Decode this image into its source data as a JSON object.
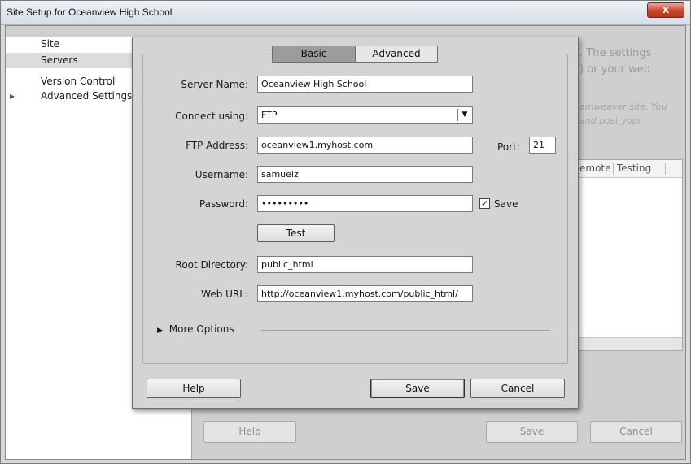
{
  "window": {
    "title": "Site Setup for Oceanview High School",
    "close_glyph": "x"
  },
  "sidebar": {
    "items": [
      {
        "label": "Site"
      },
      {
        "label": "Servers"
      },
      {
        "label": "Version Control"
      },
      {
        "label": "Advanced Settings"
      }
    ],
    "selected": "Servers",
    "expand_glyph": "▶"
  },
  "background": {
    "info_line1": ". The settings",
    "info_line2": ") or your web",
    "info_italic1": "amweaver site. You",
    "info_italic2": "and post your",
    "table_columns": [
      "emote",
      "Testing"
    ],
    "buttons": {
      "help": "Help",
      "save": "Save",
      "cancel": "Cancel"
    }
  },
  "server_dialog": {
    "tabs": [
      {
        "label": "Basic",
        "active": true
      },
      {
        "label": "Advanced",
        "active": false
      }
    ],
    "fields": {
      "server_name": {
        "label": "Server Name:",
        "value": "Oceanview High School"
      },
      "connect_using": {
        "label": "Connect using:",
        "value": "FTP"
      },
      "ftp_address": {
        "label": "FTP Address:",
        "value": "oceanview1.myhost.com"
      },
      "port": {
        "label": "Port:",
        "value": "21"
      },
      "username": {
        "label": "Username:",
        "value": "samuelz"
      },
      "password": {
        "label": "Password:",
        "value": "•••••••••"
      },
      "save_password": {
        "label": "Save",
        "checked": true
      },
      "root_directory": {
        "label": "Root Directory:",
        "value": "public_html"
      },
      "web_url": {
        "label": "Web URL:",
        "value": "http://oceanview1.myhost.com/public_html/"
      }
    },
    "test_button": "Test",
    "more_options": "More Options",
    "more_options_glyph": "▶",
    "dropdown_glyph": "▼",
    "check_glyph": "✓",
    "buttons": {
      "help": "Help",
      "save": "Save",
      "cancel": "Cancel"
    }
  },
  "colors": {
    "titlebar": "#dfe5ec",
    "close_button": "#c8452f",
    "dialog_background": "#d4d4d4",
    "active_tab": "#9c9c9c",
    "selected_sidebar_item": "#dcdcdc"
  }
}
